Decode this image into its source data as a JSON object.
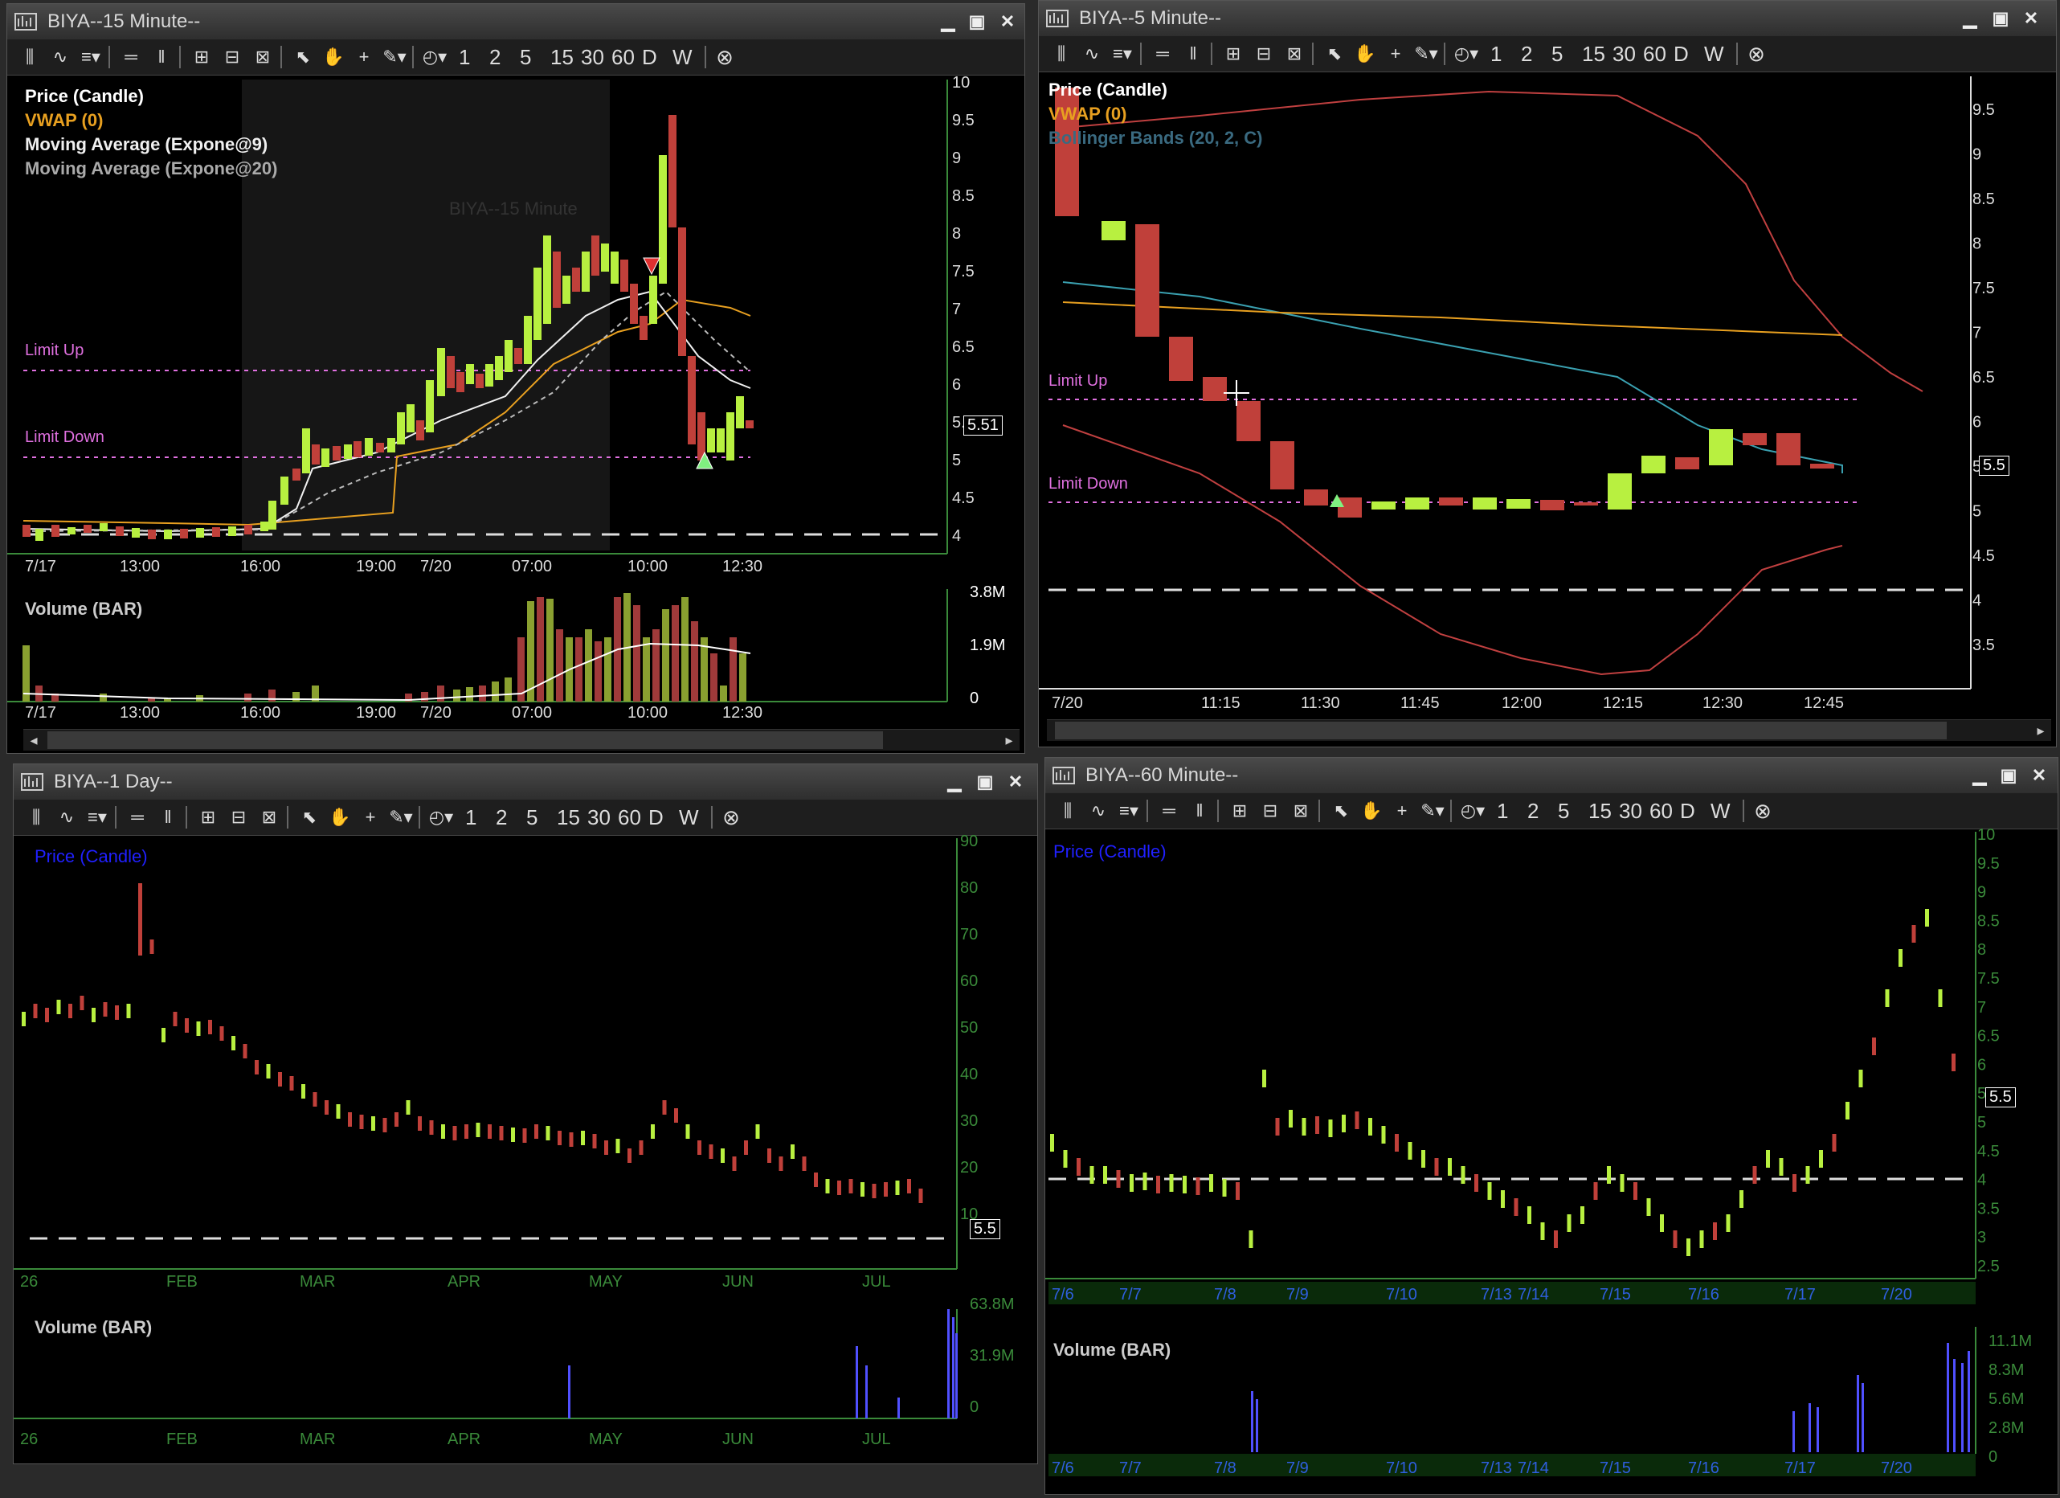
{
  "toolbar": {
    "periods": [
      "1",
      "2",
      "5",
      "15",
      "30",
      "60",
      "D",
      "W"
    ]
  },
  "windows": {
    "w15": {
      "title": "BIYA--15 Minute--",
      "legend": {
        "price": "Price (Candle)",
        "vwap": "VWAP (0)",
        "ma9": "Moving Average (Expone@9)",
        "ma20": "Moving Average (Expone@20)"
      },
      "watermark": "BIYA--15 Minute",
      "limit_up": "Limit Up",
      "limit_down": "Limit Down",
      "price_tag": "5.51",
      "volume_label": "Volume (BAR)",
      "x_labels": [
        "7/17",
        "13:00",
        "16:00",
        "19:00",
        "7/20",
        "07:00",
        "10:00",
        "12:30"
      ],
      "y_labels": [
        "10",
        "9.5",
        "9",
        "8.5",
        "8",
        "7.5",
        "7",
        "6.5",
        "6",
        "5.5",
        "5",
        "4.5",
        "4"
      ],
      "vol_labels": [
        "3.8M",
        "1.9M",
        "0"
      ]
    },
    "w5": {
      "title": "BIYA--5 Minute--",
      "legend": {
        "price": "Price (Candle)",
        "vwap": "VWAP (0)",
        "bb": "Bollinger Bands (20, 2, C)"
      },
      "limit_up": "Limit Up",
      "limit_down": "Limit Down",
      "price_tag": "5.5",
      "x_labels": [
        "7/20",
        "11:15",
        "11:30",
        "11:45",
        "12:00",
        "12:15",
        "12:30",
        "12:45"
      ],
      "y_labels": [
        "9.5",
        "9",
        "8.5",
        "8",
        "7.5",
        "7",
        "6.5",
        "6",
        "5.5",
        "5",
        "4.5",
        "4",
        "3.5"
      ]
    },
    "w1d": {
      "title": "BIYA--1 Day--",
      "legend": {
        "price": "Price (Candle)"
      },
      "price_tag": "5.5",
      "volume_label": "Volume (BAR)",
      "x_labels": [
        "26",
        "FEB",
        "MAR",
        "APR",
        "MAY",
        "JUN",
        "JUL"
      ],
      "y_labels": [
        "90",
        "80",
        "70",
        "60",
        "50",
        "40",
        "30",
        "20",
        "10"
      ],
      "vol_labels": [
        "63.8M",
        "31.9M",
        "0"
      ]
    },
    "w60": {
      "title": "BIYA--60 Minute--",
      "legend": {
        "price": "Price (Candle)"
      },
      "price_tag": "5.5",
      "volume_label": "Volume (BAR)",
      "x_labels": [
        "7/6",
        "7/7",
        "7/8",
        "7/9",
        "7/10",
        "7/13",
        "7/14",
        "7/15",
        "7/16",
        "7/17",
        "7/20"
      ],
      "y_labels": [
        "10",
        "9.5",
        "9",
        "8.5",
        "8",
        "7.5",
        "7",
        "6.5",
        "6",
        "5.5",
        "5",
        "4.5",
        "4",
        "3.5",
        "3",
        "2.5"
      ],
      "vol_labels": [
        "11.1M",
        "8.3M",
        "5.6M",
        "2.8M",
        "0"
      ]
    }
  },
  "colors": {
    "up": "#b8f040",
    "down": "#c0403a",
    "limit": "#e070e0",
    "vwap": "#e8a020",
    "grid_axis": "#3a8a3a"
  }
}
